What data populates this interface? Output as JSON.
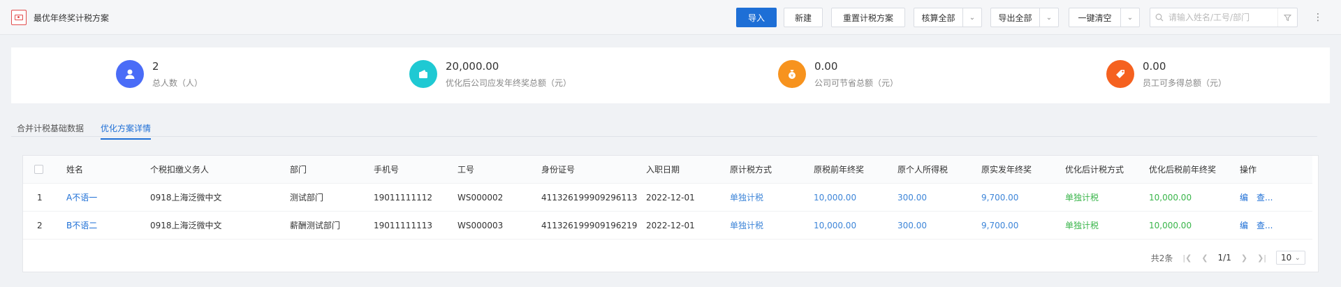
{
  "header": {
    "title": "最优年终奖计税方案",
    "buttons": {
      "import": "导入",
      "new": "新建",
      "reset": "重置计税方案",
      "calc_all": "核算全部",
      "export_all": "导出全部",
      "clear_all": "一键清空"
    },
    "search_placeholder": "请输入姓名/工号/部门"
  },
  "summary": [
    {
      "value": "2",
      "label": "总人数（人）",
      "color": "#4a6cf7",
      "icon": "person-icon"
    },
    {
      "value": "20,000.00",
      "label": "优化后公司应发年终奖总额（元）",
      "color": "#1fc9d3",
      "icon": "wallet-icon"
    },
    {
      "value": "0.00",
      "label": "公司可节省总额（元）",
      "color": "#f7931e",
      "icon": "money-bag-icon"
    },
    {
      "value": "0.00",
      "label": "员工可多得总额（元）",
      "color": "#f5611f",
      "icon": "tag-icon"
    }
  ],
  "tabs": [
    "合并计税基础数据",
    "优化方案详情"
  ],
  "table": {
    "columns": [
      "姓名",
      "个税扣缴义务人",
      "部门",
      "手机号",
      "工号",
      "身份证号",
      "入职日期",
      "原计税方式",
      "原税前年终奖",
      "原个人所得税",
      "原实发年终奖",
      "优化后计税方式",
      "优化后税前年终奖",
      "操作"
    ],
    "rows": [
      {
        "index": "1",
        "name": "A不语一",
        "withholder": "0918上海泛微中文",
        "dept": "测试部门",
        "phone": "19011111112",
        "emp_no": "WS000002",
        "id_no": "411326199909296113",
        "hire_date": "2022-12-01",
        "orig_method": "单独计税",
        "orig_pretax": "10,000.00",
        "orig_tax": "300.00",
        "orig_net": "9,700.00",
        "opt_method": "单独计税",
        "opt_pretax": "10,000.00",
        "op_edit": "编",
        "op_view": "查..."
      },
      {
        "index": "2",
        "name": "B不语二",
        "withholder": "0918上海泛微中文",
        "dept": "薪酬测试部门",
        "phone": "19011111113",
        "emp_no": "WS000003",
        "id_no": "411326199909196219",
        "hire_date": "2022-12-01",
        "orig_method": "单独计税",
        "orig_pretax": "10,000.00",
        "orig_tax": "300.00",
        "orig_net": "9,700.00",
        "opt_method": "单独计税",
        "opt_pretax": "10,000.00",
        "op_edit": "编",
        "op_view": "查..."
      }
    ]
  },
  "pager": {
    "total": "共2条",
    "page": "1/1",
    "size": "10"
  }
}
